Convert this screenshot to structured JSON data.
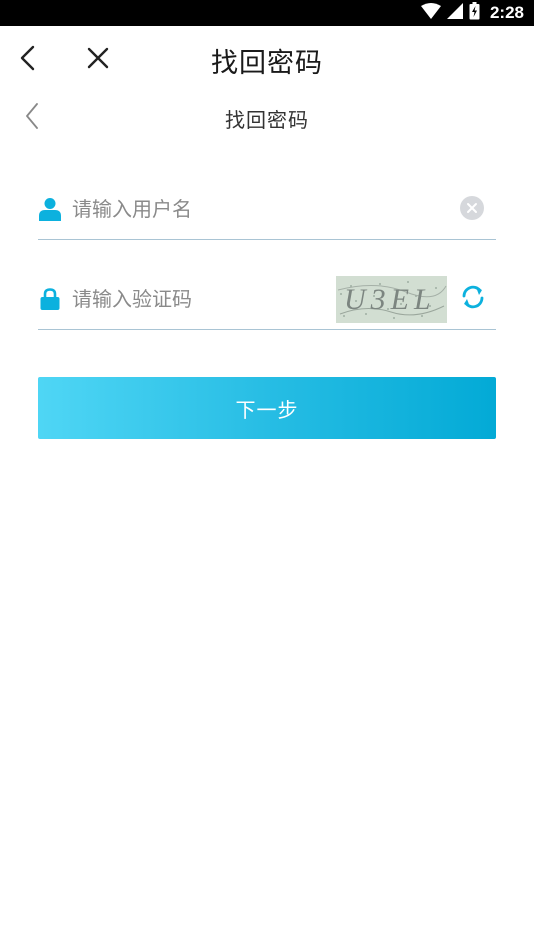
{
  "status_bar": {
    "time": "2:28",
    "icons": [
      "wifi-icon",
      "cellular-signal-icon",
      "battery-charging-icon"
    ]
  },
  "app_bar": {
    "title": "找回密码",
    "icons": [
      "back-arrow-icon",
      "close-icon"
    ]
  },
  "sub_header": {
    "title": "找回密码",
    "icons": [
      "back-chevron-icon"
    ]
  },
  "form": {
    "username": {
      "placeholder": "请输入用户名",
      "value": "",
      "icon": "user-icon",
      "clear_icon": "clear-icon"
    },
    "captcha": {
      "placeholder": "请输入验证码",
      "value": "",
      "icon": "lock-icon",
      "image_text": "U3EL",
      "refresh_icon": "refresh-icon"
    },
    "next_label": "下一步"
  },
  "colors": {
    "accent": "#00AAD6",
    "accent_light": "#4FD6F5",
    "divider": "#A9C4D4",
    "placeholder": "#8A8A8A"
  }
}
